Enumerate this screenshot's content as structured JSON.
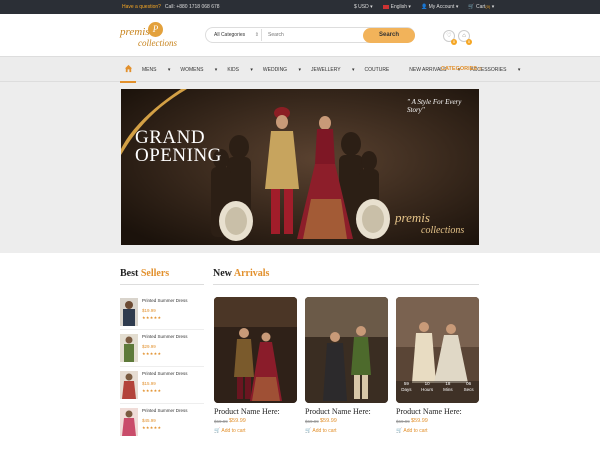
{
  "topbar": {
    "question_label": "Have a question?",
    "phone": "Call: +880 1718 068 678",
    "currency": "USD",
    "language": "English",
    "account": "My Account",
    "cart": "Cart",
    "cart_count": "(0)"
  },
  "header": {
    "logo_text_1": "premis",
    "logo_text_2": "collections",
    "logo_mono": "P",
    "category_select": "All Categories",
    "search_placeholder": "Search",
    "search_button": "Search",
    "wishlist_count": "0",
    "cart_count": "0"
  },
  "nav": {
    "items": [
      "MENS",
      "WOMENS",
      "KIDS",
      "WEDDING",
      "JEWELLERY",
      "COUTURE",
      "NEW ARRIVALS",
      "ACCESSORIES"
    ],
    "categories_label": "CATEGORIES"
  },
  "banner": {
    "title_line1": "GRAND",
    "title_line2": "OPENING",
    "tagline": "\" A Style For Every Story\"",
    "logo_text_1": "premis",
    "logo_text_2": "collections"
  },
  "best_sellers": {
    "title_main": "Best",
    "title_accent": "Sellers",
    "items": [
      {
        "name": "Printed Summer Dress",
        "price": "$19.99",
        "stars": "★★★★★"
      },
      {
        "name": "Printed Summer Dress",
        "price": "$29.99",
        "stars": "★★★★★"
      },
      {
        "name": "Printed Summer Dress",
        "price": "$15.99",
        "stars": "★★★★★"
      },
      {
        "name": "Printed Summer Dress",
        "price": "$45.99",
        "stars": "★★★★★"
      }
    ]
  },
  "new_arrivals": {
    "title_main": "New",
    "title_accent": "Arrivals",
    "products": [
      {
        "name": "Product Name Here:",
        "old_price": "$69.99",
        "price": "$59.99",
        "add": "Add to cart"
      },
      {
        "name": "Product Name Here:",
        "old_price": "$69.99",
        "price": "$59.99",
        "add": "Add to cart"
      },
      {
        "name": "Product Name Here:",
        "old_price": "$69.99",
        "price": "$59.99",
        "add": "Add to cart"
      }
    ],
    "countdown": [
      {
        "num": "59",
        "label": "Days"
      },
      {
        "num": "10",
        "label": "Hours"
      },
      {
        "num": "18",
        "label": "Mins"
      },
      {
        "num": "06",
        "label": "Secs"
      }
    ]
  }
}
